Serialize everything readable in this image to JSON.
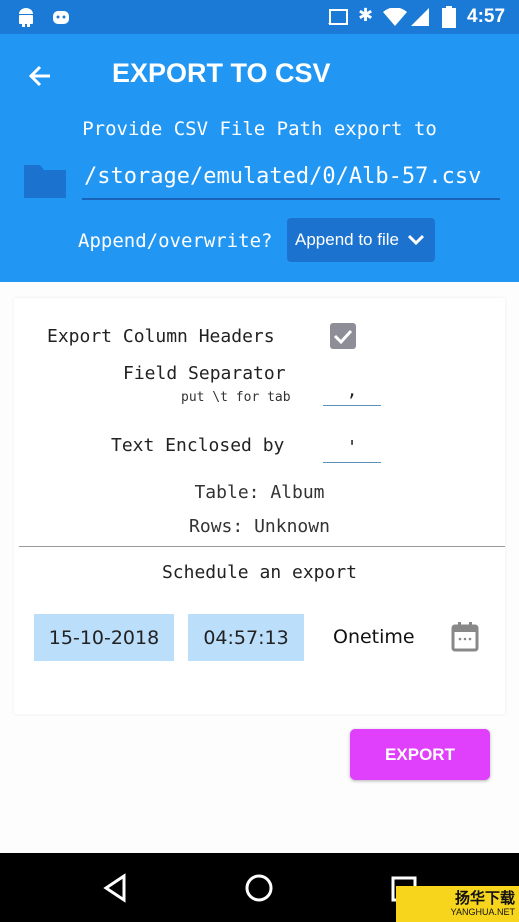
{
  "status_bar": {
    "time": "4:57",
    "icons": [
      "android-icon",
      "android-robot-icon",
      "cast-icon",
      "bluetooth-icon",
      "wifi-icon",
      "signal-icon",
      "battery-charging-icon"
    ]
  },
  "header": {
    "title": "EXPORT TO CSV",
    "path_prompt": "Provide CSV File Path export to",
    "path_value": "/storage/emulated/0/Alb-57.csv",
    "append_label": "Append/overwrite?",
    "append_selected": "Append to file"
  },
  "options": {
    "export_headers_label": "Export Column Headers",
    "export_headers_checked": true,
    "field_separator_label": "Field Separator",
    "field_separator_hint": "put \\t for tab",
    "field_separator_value": ",",
    "text_enclosed_label": "Text Enclosed by",
    "text_enclosed_value": "'",
    "table_info": "Table: Album",
    "rows_info": "Rows: Unknown"
  },
  "schedule": {
    "title": "Schedule an export",
    "date": "15-10-2018",
    "time": "04:57:13",
    "frequency": "Onetime"
  },
  "export_button": "EXPORT",
  "watermark": {
    "text_cn": "扬华下载",
    "text_en": "YANGHUA.NET"
  },
  "colors": {
    "primary": "#2196F3",
    "primary_dark": "#1A7AD6",
    "accent": "#E040FB",
    "pill": "#BBDEFB"
  }
}
